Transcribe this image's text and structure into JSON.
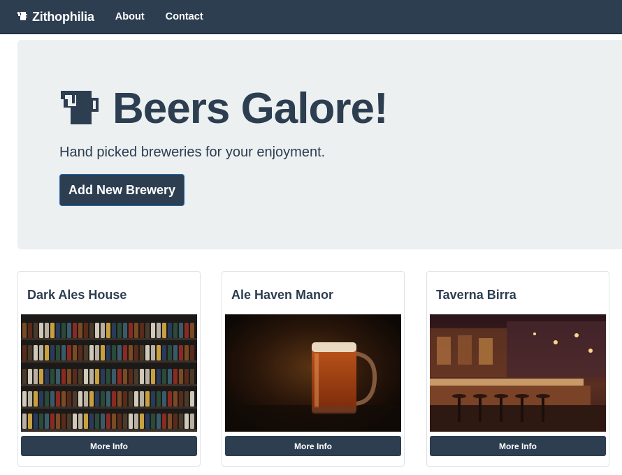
{
  "navbar": {
    "brand": "Zithophilia",
    "links": [
      "About",
      "Contact"
    ]
  },
  "jumbotron": {
    "title": "Beers Galore!",
    "lead": "Hand picked breweries for your enjoyment.",
    "button": "Add New Brewery"
  },
  "cards": [
    {
      "title": "Dark Ales House",
      "image": "beer-shelves-photo",
      "button": "More Info"
    },
    {
      "title": "Ale Haven Manor",
      "image": "beer-mug-photo",
      "button": "More Info"
    },
    {
      "title": "Taverna Birra",
      "image": "bar-interior-photo",
      "button": "More Info"
    }
  ],
  "colors": {
    "primary": "#2c3e50",
    "jumbotron_bg": "#ecf0f1"
  }
}
